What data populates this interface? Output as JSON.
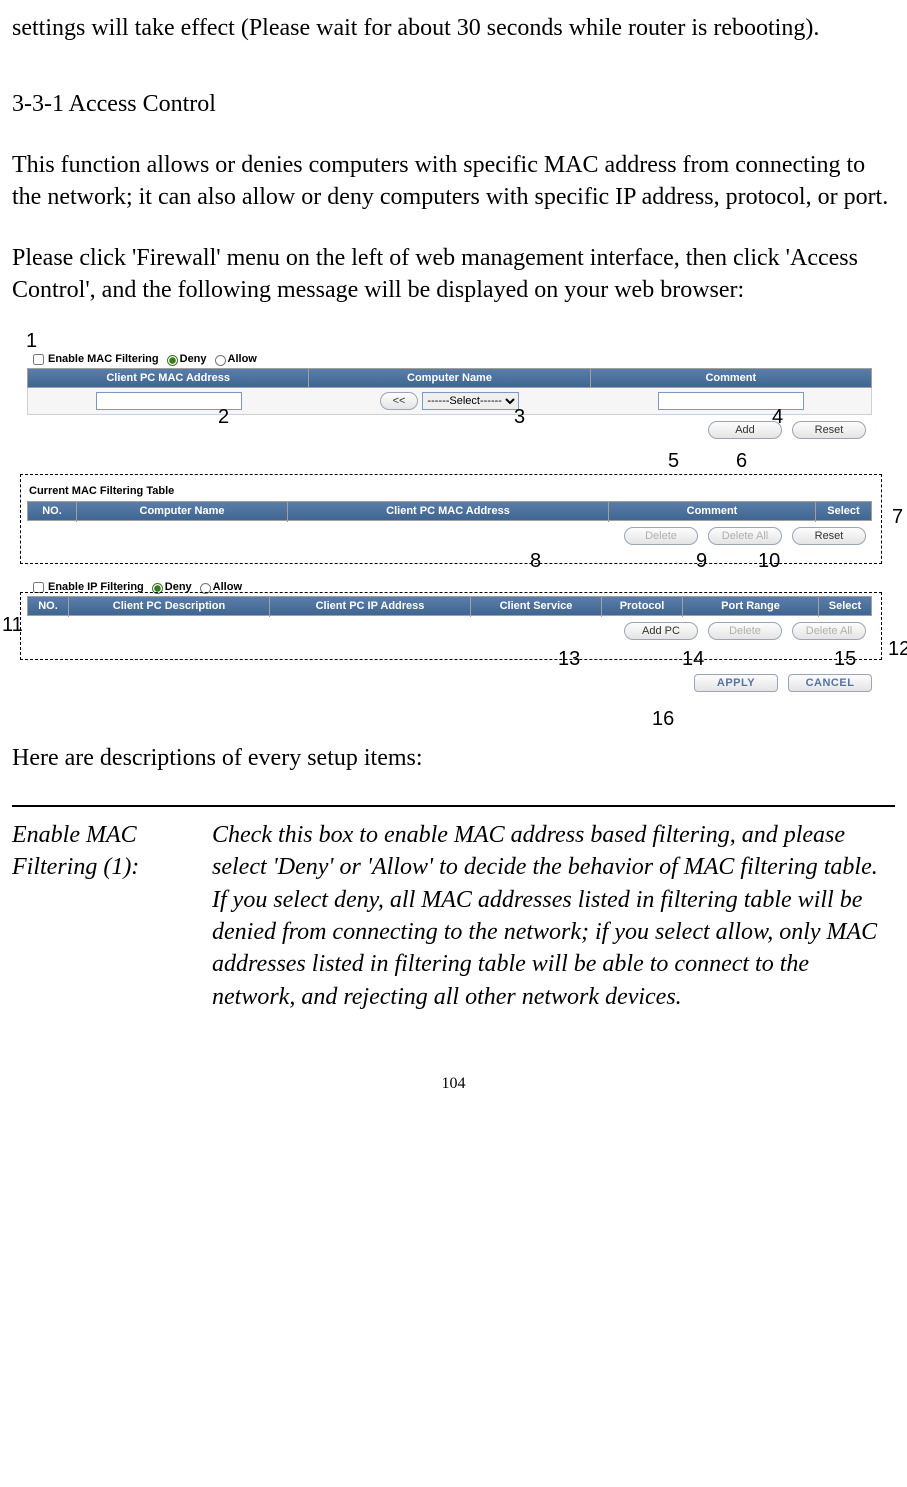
{
  "intro_line": "settings will take effect (Please wait for about 30 seconds while router is rebooting).",
  "section_heading": "3-3-1 Access Control",
  "para1": "This function allows or denies computers with specific MAC address from connecting to the network; it can also allow or deny computers with specific IP address, protocol, or port.",
  "para2": "Please click 'Firewall' menu on the left of web management interface, then click 'Access Control', and the following message will be displayed on your web browser:",
  "mac": {
    "enable_label": "Enable MAC Filtering",
    "deny": "Deny",
    "allow": "Allow",
    "col_mac": "Client PC MAC Address",
    "col_name": "Computer Name",
    "col_comment": "Comment",
    "copy_btn": "<<",
    "select_default": "------Select------",
    "add": "Add",
    "reset": "Reset"
  },
  "current": {
    "title": "Current MAC Filtering Table",
    "col_no": "NO.",
    "col_name": "Computer Name",
    "col_mac": "Client PC MAC Address",
    "col_comment": "Comment",
    "col_select": "Select",
    "del": "Delete",
    "del_all": "Delete All",
    "reset": "Reset"
  },
  "ip": {
    "enable_label": "Enable IP Filtering",
    "deny": "Deny",
    "allow": "Allow",
    "col_no": "NO.",
    "col_desc": "Client PC Description",
    "col_ip": "Client PC IP Address",
    "col_service": "Client Service",
    "col_proto": "Protocol",
    "col_range": "Port Range",
    "col_select": "Select",
    "add_pc": "Add PC",
    "del": "Delete",
    "del_all": "Delete All"
  },
  "apply": "APPLY",
  "cancel": "CANCEL",
  "annots": {
    "a1": "1",
    "a2": "2",
    "a3": "3",
    "a4": "4",
    "a5": "5",
    "a6": "6",
    "a7": "7",
    "a8": "8",
    "a9": "9",
    "a10": "10",
    "a11": "11",
    "a12": "12",
    "a13": "13",
    "a14": "14",
    "a15": "15",
    "a16": "16"
  },
  "desc_intro": "Here are descriptions of every setup items:",
  "desc_label": "Enable MAC Filtering (1):",
  "desc_text": "Check this box to enable MAC address based filtering, and please select 'Deny' or 'Allow' to decide the behavior of MAC filtering table. If you select deny, all MAC addresses listed in filtering table will be denied from connecting to the network; if you select allow, only MAC addresses listed in filtering table will be able to connect to the network, and rejecting all other network devices.",
  "page_number": "104"
}
